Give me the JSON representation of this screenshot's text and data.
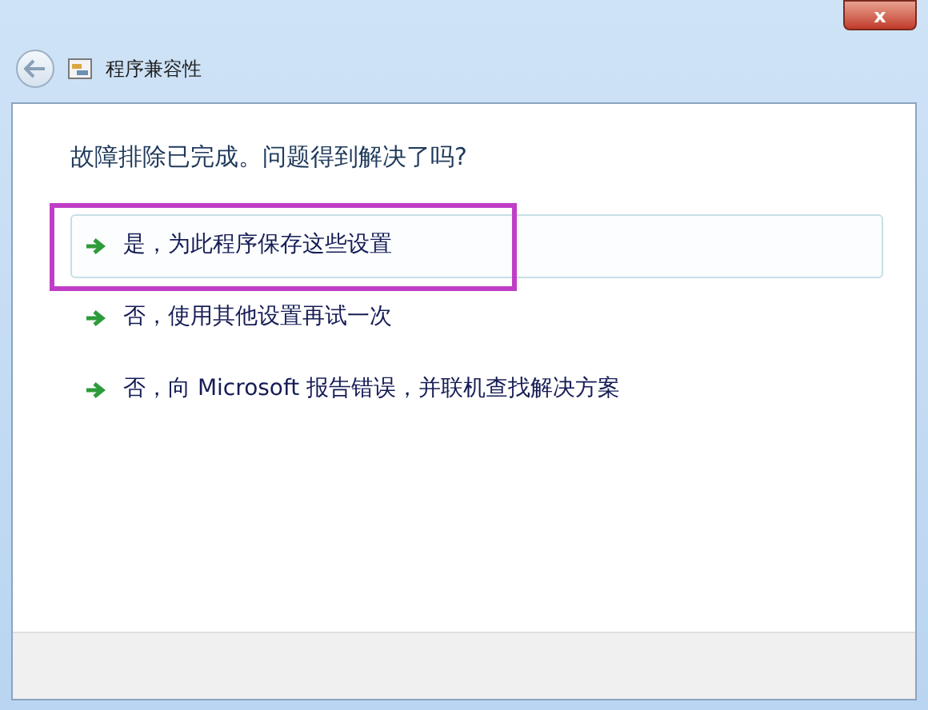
{
  "window": {
    "title": "程序兼容性",
    "close_label": "x"
  },
  "heading": "故障排除已完成。问题得到解决了吗?",
  "options": [
    {
      "label": "是，为此程序保存这些设置",
      "hovered": true,
      "annotated": true
    },
    {
      "label": "否，使用其他设置再试一次",
      "hovered": false,
      "annotated": false
    },
    {
      "label": "否，向 Microsoft 报告错误，并联机查找解决方案",
      "hovered": false,
      "annotated": false
    }
  ]
}
